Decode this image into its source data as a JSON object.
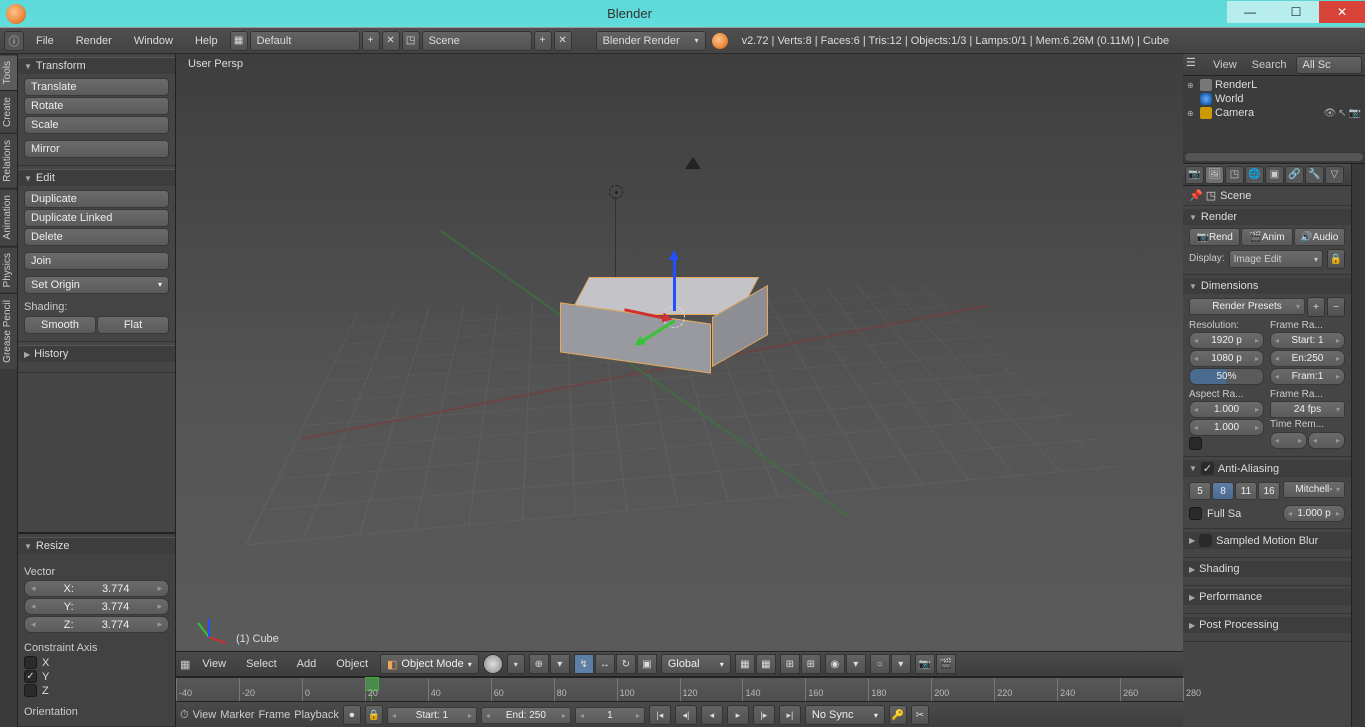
{
  "window": {
    "title": "Blender"
  },
  "topmenu": {
    "file": "File",
    "render": "Render",
    "window": "Window",
    "help": "Help"
  },
  "layout_combo": "Default",
  "scene_combo": "Scene",
  "engine_combo": "Blender Render",
  "stats": "v2.72 | Verts:8 | Faces:6 | Tris:12 | Objects:1/3 | Lamps:0/1 | Mem:6.26M (0.11M) | Cube",
  "vtabs": [
    "Tools",
    "Create",
    "Relations",
    "Animation",
    "Physics",
    "Grease Pencil"
  ],
  "toolshelf": {
    "transform": {
      "title": "Transform",
      "translate": "Translate",
      "rotate": "Rotate",
      "scale": "Scale",
      "mirror": "Mirror"
    },
    "edit": {
      "title": "Edit",
      "duplicate": "Duplicate",
      "duplicate_linked": "Duplicate Linked",
      "delete": "Delete",
      "join": "Join",
      "set_origin": "Set Origin",
      "shading": "Shading:",
      "smooth": "Smooth",
      "flat": "Flat"
    },
    "history": {
      "title": "History"
    }
  },
  "operator": {
    "title": "Resize",
    "vector_label": "Vector",
    "x": "3.774",
    "y": "3.774",
    "z": "3.774",
    "constraint_label": "Constraint Axis",
    "cx": "X",
    "cy": "Y",
    "cz": "Z",
    "orientation": "Orientation"
  },
  "viewport": {
    "persp": "User Persp",
    "object": "(1) Cube",
    "menus": {
      "view": "View",
      "select": "Select",
      "add": "Add",
      "object": "Object"
    },
    "mode": "Object Mode",
    "orient": "Global"
  },
  "timeline": {
    "menus": {
      "view": "View",
      "marker": "Marker",
      "frame": "Frame",
      "playback": "Playback"
    },
    "start_label": "Start:",
    "start": "1",
    "end_label": "End:",
    "end": "250",
    "cur": "1",
    "sync": "No Sync",
    "ticks": [
      -40,
      -20,
      0,
      20,
      40,
      60,
      80,
      100,
      120,
      140,
      160,
      180,
      200,
      220,
      240,
      260,
      280
    ]
  },
  "outliner": {
    "view": "View",
    "search": "Search",
    "all": "All Sc",
    "items": [
      {
        "name": "RenderL",
        "icon": "◧"
      },
      {
        "name": "World",
        "icon": "🌐"
      },
      {
        "name": "Camera",
        "icon": "📷",
        "restrict": true
      }
    ]
  },
  "props": {
    "breadcrumb": "Scene",
    "render": {
      "title": "Render",
      "render_btn": "Rend",
      "anim_btn": "Anim",
      "audio_btn": "Audio",
      "display": "Display:",
      "display_val": "Image Edit"
    },
    "dimensions": {
      "title": "Dimensions",
      "presets": "Render Presets",
      "res_label": "Resolution:",
      "res_x": "1920 p",
      "res_y": "1080 p",
      "res_pct": "50%",
      "framerange": "Frame Ra...",
      "start": "Start: 1",
      "end": "En:250",
      "step": "Fram:1",
      "aspect": "Aspect Ra...",
      "ax": "1.000",
      "ay": "1.000",
      "framerate": "Frame Ra...",
      "fps": "24 fps",
      "timerem": "Time Rem..."
    },
    "aa": {
      "title": "Anti-Aliasing",
      "s5": "5",
      "s8": "8",
      "s11": "11",
      "s16": "16",
      "filter": "Mitchell-",
      "fullsa": "Full Sa",
      "size": "1.000 p"
    },
    "motionblur": "Sampled Motion Blur",
    "shading": "Shading",
    "performance": "Performance",
    "post": "Post Processing"
  }
}
